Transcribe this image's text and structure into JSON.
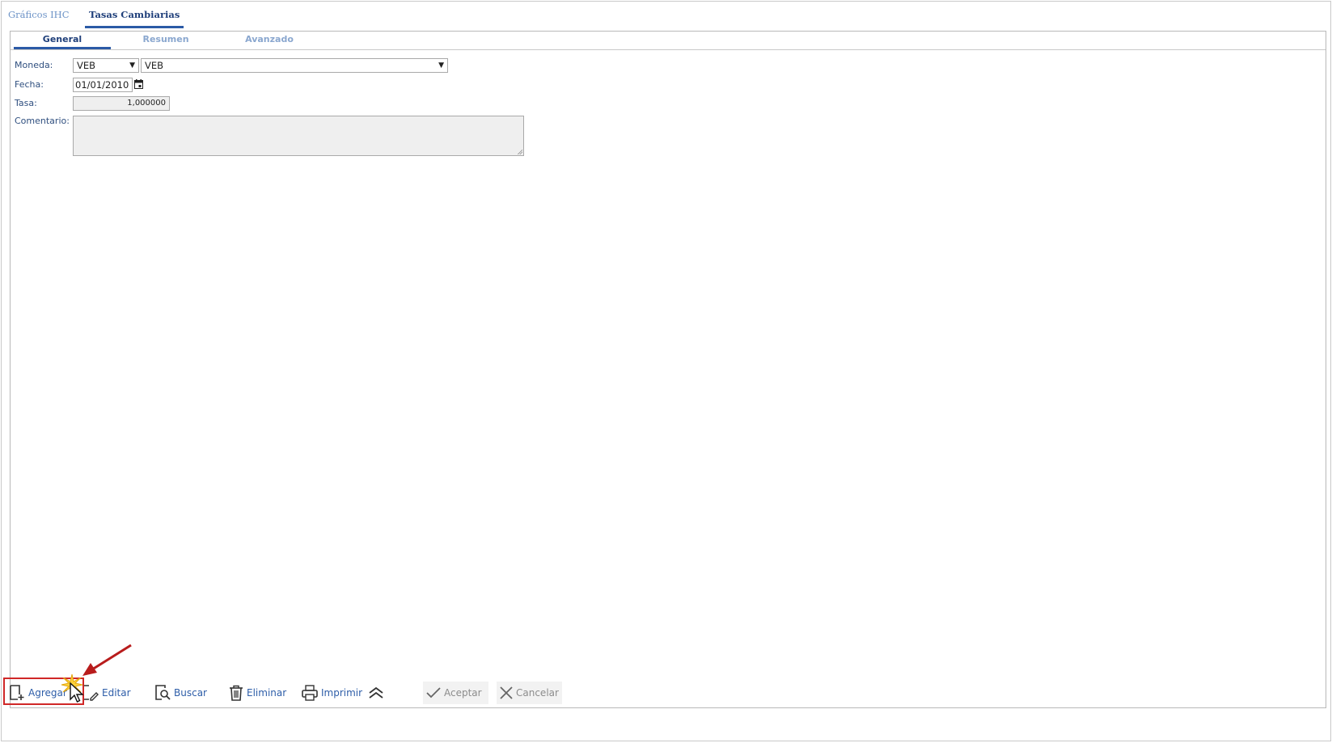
{
  "top_tabs": [
    {
      "label": "Gráficos IHC",
      "active": false
    },
    {
      "label": "Tasas Cambiarias",
      "active": true
    }
  ],
  "sub_tabs": [
    {
      "label": "General",
      "active": true
    },
    {
      "label": "Resumen",
      "active": false
    },
    {
      "label": "Avanzado",
      "active": false
    }
  ],
  "form": {
    "moneda_label": "Moneda:",
    "moneda_code": "VEB",
    "moneda_name": "VEB",
    "fecha_label": "Fecha:",
    "fecha_value": "01/01/2010",
    "tasa_label": "Tasa:",
    "tasa_value": "1,000000",
    "comentario_label": "Comentario:",
    "comentario_value": ""
  },
  "toolbar": {
    "agregar": "Agregar",
    "editar": "Editar",
    "buscar": "Buscar",
    "eliminar": "Eliminar",
    "imprimir": "Imprimir",
    "aceptar": "Aceptar",
    "cancelar": "Cancelar"
  },
  "colors": {
    "accent": "#2b5aa6",
    "link": "#2d5da8",
    "highlight": "#d02727"
  }
}
